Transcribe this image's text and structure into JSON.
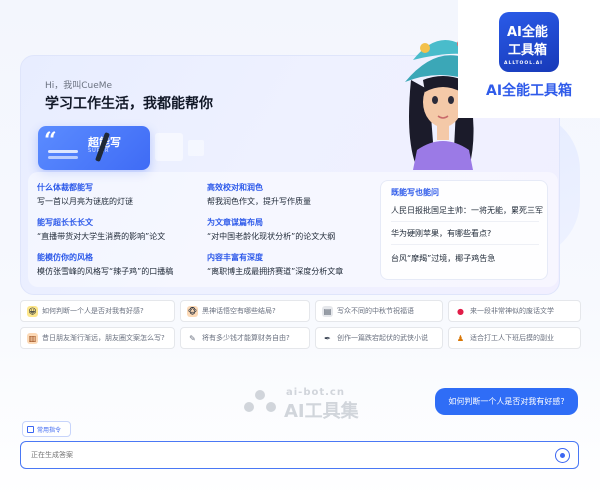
{
  "hero": {
    "greeting": "Hi，我叫CueMe",
    "title": "学习工作生活，我都能帮你",
    "badge_label": "超能写",
    "badge_sub": "SUPER"
  },
  "features": [
    {
      "title": "什么体裁都能写",
      "desc": "写一首以月亮为谜底的灯谜"
    },
    {
      "title": "高效校对和润色",
      "desc": "帮我润色作文，提升写作质量"
    },
    {
      "title": "能写超长长长文",
      "desc": "“直播带货对大学生消费的影响”论文"
    },
    {
      "title": "为文章谋篇布局",
      "desc": "“对中国老龄化现状分析”的论文大纲"
    },
    {
      "title": "能模仿你的风格",
      "desc": "模仿张雪峰的风格写“辣子鸡”的口播稿"
    },
    {
      "title": "内容丰富有深度",
      "desc": "“离职博主成最拥挤赛道”深度分析文章"
    }
  ],
  "hot": {
    "title": "既能写也能问",
    "items": [
      "人民日报批国足主帅：一将无能，累死三军",
      "华为硬刚苹果，有哪些看点?",
      "台风“摩羯”过境，椰子鸡告急"
    ]
  },
  "chips": [
    {
      "icon": "emoji-face-icon",
      "glyph": "😀",
      "text": "如何判断一个人是否对我有好感?"
    },
    {
      "icon": "monkey-icon",
      "glyph": "🐵",
      "text": "黑神话悟空有哪些结局?"
    },
    {
      "icon": "doc-icon",
      "glyph": "▤",
      "text": "写众不同的中秋节祝福语"
    },
    {
      "icon": "apple-icon",
      "glyph": "●",
      "text": "来一段非常神似的废话文学"
    },
    {
      "icon": "notebook-icon",
      "glyph": "▥",
      "text": "昔日朋友渐行渐远，朋友圈文案怎么写?"
    },
    {
      "icon": "money-icon",
      "glyph": "✎",
      "text": "将有多少钱才能算财务自由?"
    },
    {
      "icon": "pen-icon",
      "glyph": "✒",
      "text": "创作一篇跌宕起伏的武侠小说"
    },
    {
      "icon": "worker-icon",
      "glyph": "♟",
      "text": "适合打工人下班后摸的副业"
    }
  ],
  "watermark": {
    "small": "ai-bot.cn",
    "big": "AI工具集"
  },
  "message": {
    "user_text": "如何判断一个人是否对我有好感?"
  },
  "command_button": "常用指令",
  "input": {
    "placeholder": "正在生成答案"
  },
  "logo": {
    "line1": "AI全能",
    "line2": "工具箱",
    "line3": "ALLTOOL.AI",
    "caption": "AI全能工具箱"
  }
}
